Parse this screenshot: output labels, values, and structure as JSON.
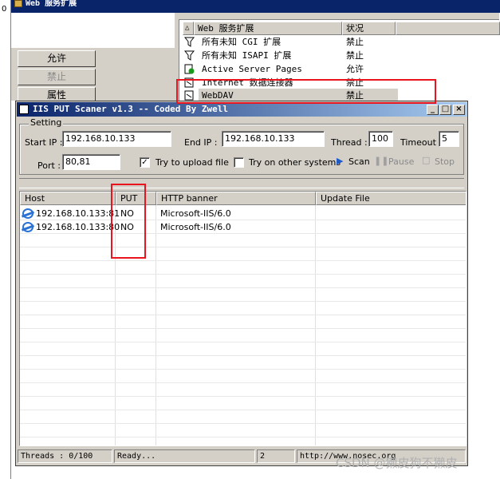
{
  "background_window": {
    "left_edge_char": "0",
    "title": "Web 服务扩展",
    "buttons": [
      {
        "label": "允许",
        "enabled": true
      },
      {
        "label": "禁止",
        "enabled": false
      },
      {
        "label": "属性",
        "enabled": true
      }
    ],
    "list": {
      "headers": [
        "Web 服务扩展",
        "状况"
      ],
      "rows": [
        {
          "name": "所有未知 CGI 扩展",
          "status": "禁止",
          "icon": "filter-icon"
        },
        {
          "name": "所有未知 ISAPI 扩展",
          "status": "禁止",
          "icon": "filter-icon"
        },
        {
          "name": "Active Server Pages",
          "status": "允许",
          "icon": "allowed-extension-icon"
        },
        {
          "name": "Internet 数据连接器",
          "status": "禁止",
          "icon": "extension-icon"
        },
        {
          "name": "WebDAV",
          "status": "禁止",
          "icon": "extension-icon"
        }
      ]
    }
  },
  "scanner": {
    "title": "IIS PUT Scaner v1.3 -- Coded By Zwell",
    "setting_title": "Setting",
    "start_ip_label": "Start IP :",
    "start_ip": "192.168.10.133",
    "end_ip_label": "End IP :",
    "end_ip": "192.168.10.133",
    "thread_label": "Thread :",
    "thread": "100",
    "timeout_label": "Timeout :",
    "timeout": "5",
    "port_label": "Port :",
    "port": "80,81",
    "upload_label": "Try to upload file",
    "upload_checked": true,
    "other_label": "Try on other systems",
    "other_checked": false,
    "scan_label": "Scan",
    "pause_label": "Pause",
    "stop_label": "Stop",
    "columns": [
      "Host",
      "PUT",
      "HTTP banner",
      "Update File"
    ],
    "results": [
      {
        "host": "192.168.10.133:81",
        "put": "NO",
        "banner": "Microsoft-IIS/6.0",
        "file": ""
      },
      {
        "host": "192.168.10.133:80",
        "put": "NO",
        "banner": "Microsoft-IIS/6.0",
        "file": ""
      }
    ],
    "status": {
      "threads": "Threads : 0/100",
      "state": "Ready...",
      "count": "2",
      "url": "http://www.nosec.org"
    }
  },
  "watermark": "CSDN @獭皮狗不獭皮",
  "colors": {
    "highlight": "#e8141e",
    "titlebar": "#0a246a",
    "face": "#d4d0c8"
  }
}
